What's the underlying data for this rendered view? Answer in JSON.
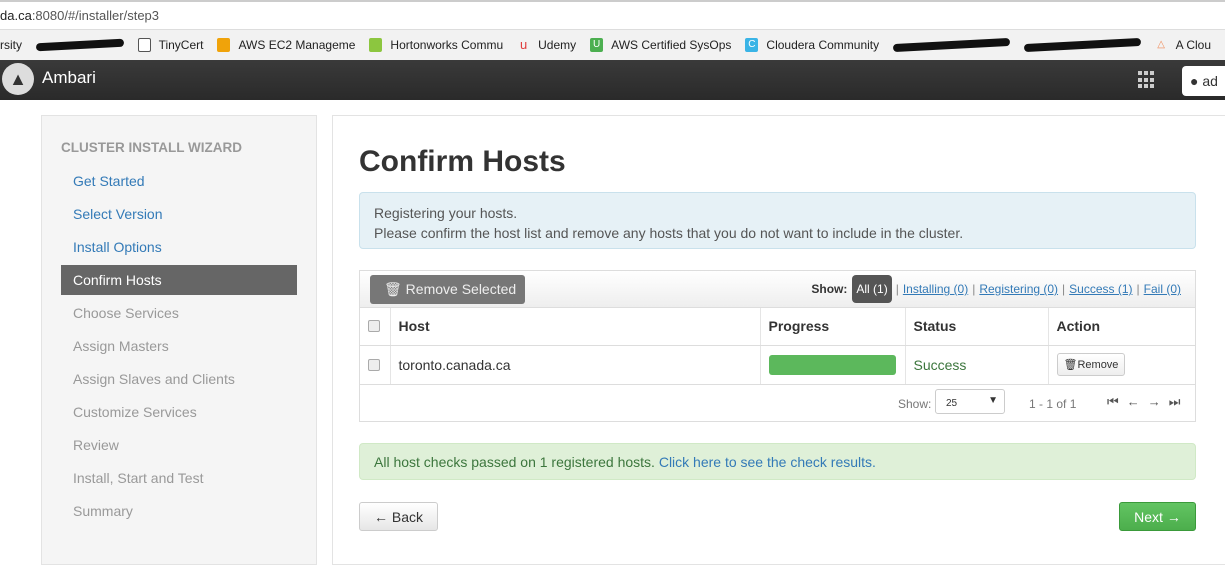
{
  "browser": {
    "url_host": "da.ca",
    "url_rest": ":8080/#/installer/step3",
    "bookmarks": [
      {
        "label": "rsity",
        "icon": "bookmark-icon",
        "color": "#555"
      },
      {
        "label": "TinyCert",
        "icon": "page-icon",
        "color": "#666"
      },
      {
        "label": "AWS EC2 Manageme",
        "icon": "aws-icon",
        "color": "#f0a30a"
      },
      {
        "label": "Hortonworks Commu",
        "icon": "hortonworks-icon",
        "color": "#8cc63f"
      },
      {
        "label": "Udemy",
        "icon": "udemy-icon",
        "color": "#e03d3d"
      },
      {
        "label": "AWS Certified SysOps",
        "icon": "u-icon",
        "color": "#4caf50"
      },
      {
        "label": "Cloudera Community",
        "icon": "c-icon",
        "color": "#3ab4e6"
      },
      {
        "label": "A Clou",
        "icon": "cloud-icon",
        "color": "#f08c5a"
      }
    ]
  },
  "navbar": {
    "brand": "Ambari",
    "user": "ad"
  },
  "sidebar": {
    "title": "CLUSTER INSTALL WIZARD",
    "items": [
      {
        "label": "Get Started",
        "state": "link"
      },
      {
        "label": "Select Version",
        "state": "link"
      },
      {
        "label": "Install Options",
        "state": "link"
      },
      {
        "label": "Confirm Hosts",
        "state": "active"
      },
      {
        "label": "Choose Services",
        "state": "disabled"
      },
      {
        "label": "Assign Masters",
        "state": "disabled"
      },
      {
        "label": "Assign Slaves and Clients",
        "state": "disabled"
      },
      {
        "label": "Customize Services",
        "state": "disabled"
      },
      {
        "label": "Review",
        "state": "disabled"
      },
      {
        "label": "Install, Start and Test",
        "state": "disabled"
      },
      {
        "label": "Summary",
        "state": "disabled"
      }
    ]
  },
  "main": {
    "title": "Confirm Hosts",
    "info_line1": "Registering your hosts.",
    "info_line2": "Please confirm the host list and remove any hosts that you do not want to include in the cluster.",
    "remove_selected": "Remove Selected",
    "show_label": "Show:",
    "filters": {
      "all": "All (1)",
      "installing": "Installing (0)",
      "registering": "Registering (0)",
      "success": "Success (1)",
      "fail": "Fail (0)"
    },
    "columns": [
      "Host",
      "Progress",
      "Status",
      "Action"
    ],
    "rows": [
      {
        "host": "toronto.canada.ca",
        "progress": 100,
        "status": "Success",
        "action": "Remove"
      }
    ],
    "pager": {
      "show_label": "Show:",
      "page_size": "25",
      "range": "1 - 1 of 1"
    },
    "checks_text": "All host checks passed on 1 registered hosts. ",
    "checks_link": "Click here to see the check results.",
    "back": "← Back",
    "next": "Next →"
  }
}
